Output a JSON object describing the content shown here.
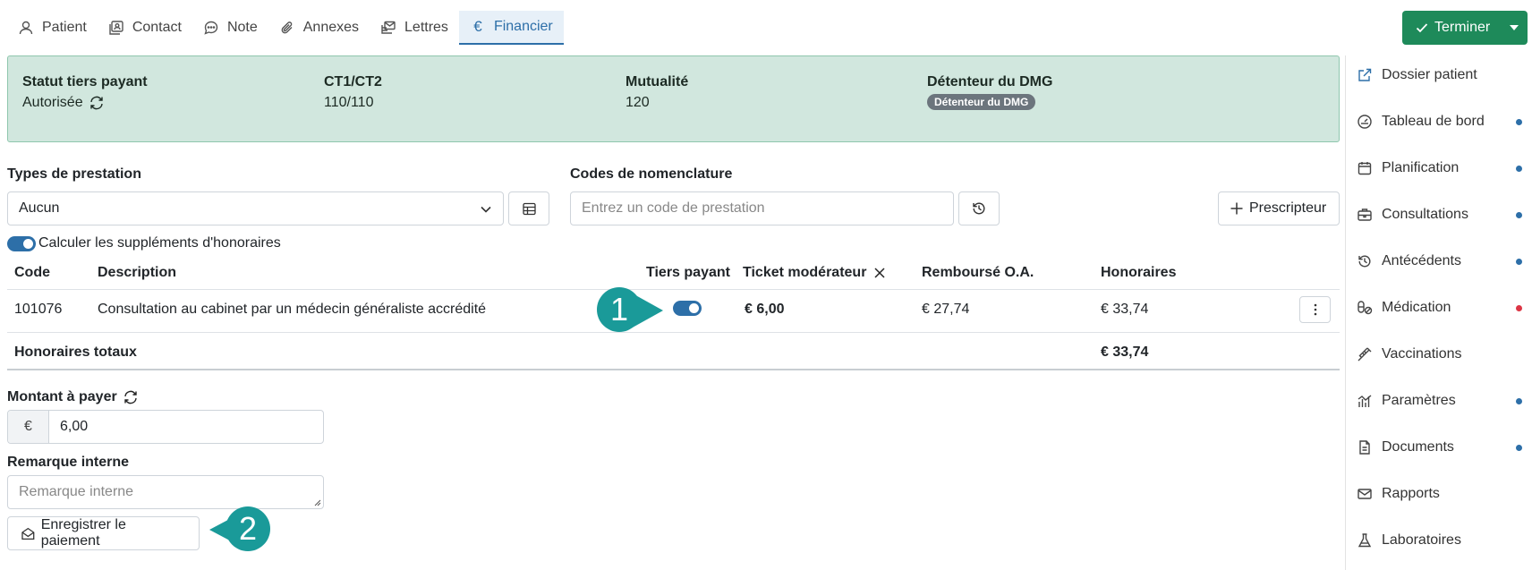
{
  "tabs": [
    {
      "label": "Patient",
      "icon": "user-icon"
    },
    {
      "label": "Contact",
      "icon": "contact-card-icon"
    },
    {
      "label": "Note",
      "icon": "chat-bubble-icon"
    },
    {
      "label": "Annexes",
      "icon": "paperclip-icon"
    },
    {
      "label": "Lettres",
      "icon": "letters-icon"
    },
    {
      "label": "Financier",
      "icon": "euro-icon",
      "active": true
    }
  ],
  "terminer": {
    "label": "Terminer"
  },
  "info": {
    "statut_label": "Statut tiers payant",
    "statut_value": "Autorisée",
    "ct_label": "CT1/CT2",
    "ct_value": "110/110",
    "mutualite_label": "Mutualité",
    "mutualite_value": "120",
    "dmg_label": "Détenteur du DMG",
    "dmg_badge": "Détenteur du DMG"
  },
  "form": {
    "types_label": "Types de prestation",
    "types_value": "Aucun",
    "codes_label": "Codes de nomenclature",
    "codes_placeholder": "Entrez un code de prestation",
    "prescripteur_label": "Prescripteur",
    "supplements_label": "Calculer les suppléments d'honoraires"
  },
  "table": {
    "headers": {
      "code": "Code",
      "description": "Description",
      "tiers": "Tiers payant",
      "ticket": "Ticket modérateur",
      "rembourse": "Remboursé O.A.",
      "honoraires": "Honoraires"
    },
    "row": {
      "code": "101076",
      "description": "Consultation au cabinet par un médecin généraliste accrédité",
      "ticket": "€ 6,00",
      "rembourse": "€ 27,74",
      "honoraires": "€ 33,74"
    },
    "total_label": "Honoraires totaux",
    "total_value": "€ 33,74"
  },
  "payment": {
    "montant_label": "Montant à payer",
    "currency": "€",
    "montant_value": "6,00",
    "remarque_label": "Remarque interne",
    "remarque_placeholder": "Remarque interne",
    "save_label": "Enregistrer le paiement"
  },
  "sidebar": {
    "items": [
      {
        "label": "Dossier patient",
        "icon": "external-link-icon",
        "dot": ""
      },
      {
        "label": "Tableau de bord",
        "icon": "dashboard-icon",
        "dot": "blue"
      },
      {
        "label": "Planification",
        "icon": "calendar-icon",
        "dot": "blue"
      },
      {
        "label": "Consultations",
        "icon": "briefcase-icon",
        "dot": "blue"
      },
      {
        "label": "Antécédents",
        "icon": "history-icon",
        "dot": "blue"
      },
      {
        "label": "Médication",
        "icon": "pills-icon",
        "dot": "red"
      },
      {
        "label": "Vaccinations",
        "icon": "syringe-icon",
        "dot": ""
      },
      {
        "label": "Paramètres",
        "icon": "chart-icon",
        "dot": "blue"
      },
      {
        "label": "Documents",
        "icon": "document-icon",
        "dot": "blue"
      },
      {
        "label": "Rapports",
        "icon": "envelope-icon",
        "dot": ""
      },
      {
        "label": "Laboratoires",
        "icon": "flask-icon",
        "dot": ""
      }
    ]
  },
  "callouts": {
    "one": "1",
    "two": "2"
  },
  "colors": {
    "accent": "#2d6fa8",
    "success": "#1e8a5a",
    "info_bg": "#d1e7de",
    "callout": "#1a9a99"
  }
}
